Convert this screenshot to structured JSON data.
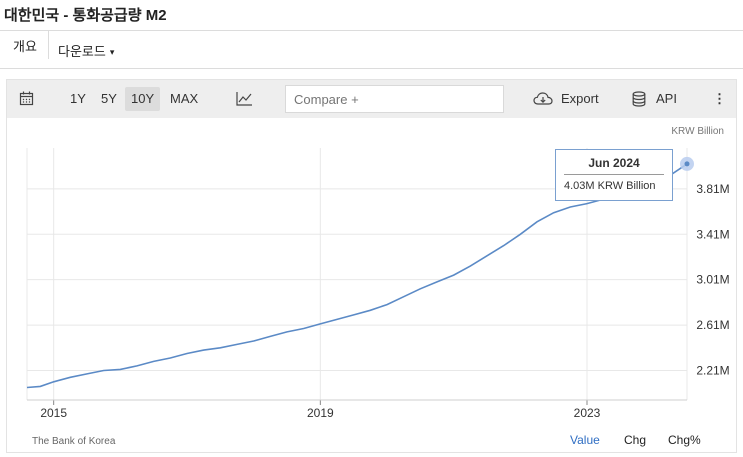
{
  "page_title": "대한민국 - 통화공급량 M2",
  "nav": {
    "overview": "개요",
    "download": "다운로드",
    "download_caret": "▾"
  },
  "toolbar": {
    "calendar_icon": "calendar-icon",
    "ranges": [
      "1Y",
      "5Y",
      "10Y",
      "MAX"
    ],
    "active_range": "10Y",
    "chart_type_icon": "line-chart-icon",
    "compare_placeholder": "Compare +",
    "export_label": "Export",
    "api_label": "API",
    "more_icon": "⋮"
  },
  "source": "The Bank of Korea",
  "modes": {
    "value": "Value",
    "chg": "Chg",
    "chg_pct": "Chg%"
  },
  "accent_color": "#5b8ac6",
  "tooltip": {
    "date": "Jun 2024",
    "value": "4.03M KRW Billion"
  },
  "chart_data": {
    "type": "line",
    "unit": "KRW Billion",
    "x_ticks": [
      "2015",
      "2019",
      "2023"
    ],
    "y_ticks": [
      "2.21M",
      "2.61M",
      "3.01M",
      "3.41M",
      "3.81M"
    ],
    "y_tick_values": [
      2.21,
      2.61,
      3.01,
      3.41,
      3.81
    ],
    "ylim": [
      1.95,
      4.17
    ],
    "xlim": [
      2014.6,
      2024.5
    ],
    "grid": true,
    "series": [
      {
        "x": [
          2014.6,
          2014.8,
          2015.0,
          2015.25,
          2015.5,
          2015.75,
          2016.0,
          2016.25,
          2016.5,
          2016.75,
          2017.0,
          2017.25,
          2017.5,
          2017.75,
          2018.0,
          2018.25,
          2018.5,
          2018.75,
          2019.0,
          2019.25,
          2019.5,
          2019.75,
          2020.0,
          2020.25,
          2020.5,
          2020.75,
          2021.0,
          2021.25,
          2021.5,
          2021.75,
          2022.0,
          2022.25,
          2022.5,
          2022.75,
          2023.0,
          2023.25,
          2023.5,
          2023.75,
          2024.0,
          2024.25,
          2024.5
        ],
        "y": [
          2.06,
          2.07,
          2.11,
          2.15,
          2.18,
          2.21,
          2.22,
          2.25,
          2.29,
          2.32,
          2.36,
          2.39,
          2.41,
          2.44,
          2.47,
          2.51,
          2.55,
          2.58,
          2.62,
          2.66,
          2.7,
          2.74,
          2.79,
          2.86,
          2.93,
          2.99,
          3.05,
          3.13,
          3.22,
          3.31,
          3.41,
          3.52,
          3.6,
          3.65,
          3.68,
          3.72,
          3.75,
          3.79,
          3.85,
          3.93,
          4.03
        ]
      }
    ]
  }
}
